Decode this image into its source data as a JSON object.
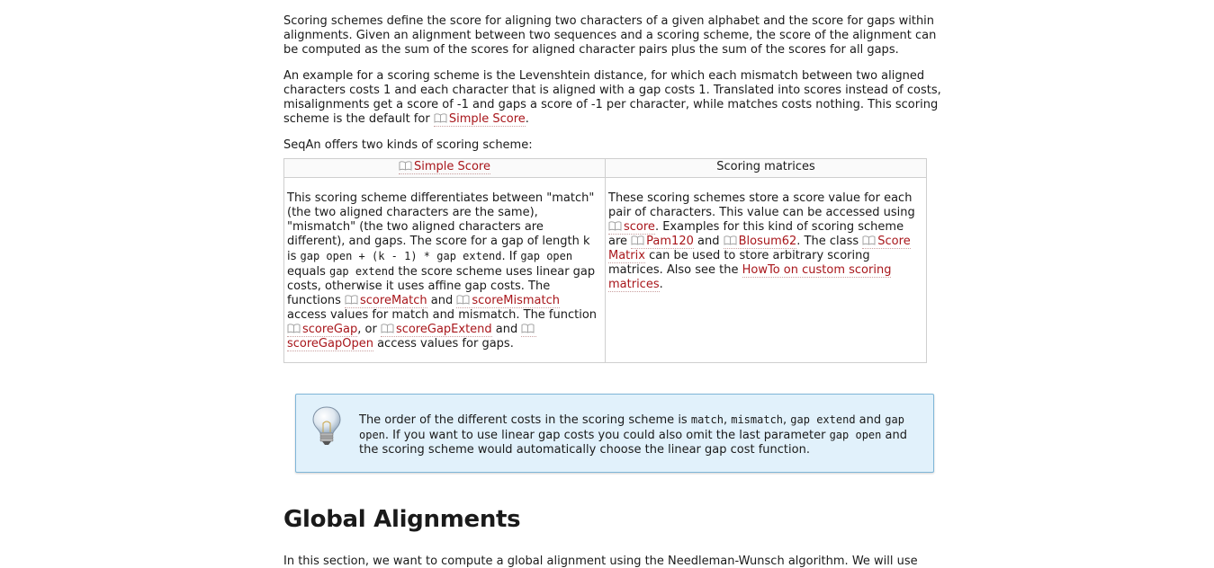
{
  "intro": {
    "p1": "Scoring schemes define the score for aligning two characters of a given alphabet and the score for gaps within alignments. Given an alignment between two sequences and a scoring scheme, the score of the alignment can be computed as the sum of the scores for aligned character pairs plus the sum of the scores for all gaps.",
    "p2_text": "An example for a scoring scheme is the Levenshtein distance, for which each mismatch between two aligned characters costs 1 and each character that is aligned with a gap costs 1. Translated into scores instead of costs, misalignments get a score of -1 and gaps a score of -1 per character, while matches costs nothing. This scoring scheme is the default for ",
    "p2_link": "Simple Score",
    "p2_end": ".",
    "p3": "SeqAn offers two kinds of scoring scheme:"
  },
  "table": {
    "col1_header_link": "Simple Score",
    "col2_header": "Scoring matrices",
    "col1": {
      "t1": "This scoring scheme differentiates between \"match\" (the two aligned characters are the same), \"mismatch\" (the two aligned characters are different), and gaps. The score for a gap of length k is ",
      "c1": "gap open + (k - 1) * gap extend",
      "t2": ". If ",
      "c2": "gap open",
      "t3": " equals ",
      "c3": "gap extend",
      "t4": " the score scheme uses linear gap costs, otherwise it uses affine gap costs. The functions ",
      "l1": "scoreMatch",
      "t5": " and ",
      "l2": "scoreMismatch",
      "t6": " access values for match and mismatch. The function ",
      "l3": "scoreGap",
      "t7": ", or ",
      "l4": "scoreGapExtend",
      "t8": " and ",
      "l5": "scoreGapOpen",
      "t9": " access values for gaps."
    },
    "col2": {
      "t1": "These scoring schemes store a score value for each pair of characters. This value can be accessed using ",
      "l1": "score",
      "t2": ". Examples for this kind of scoring scheme are ",
      "l2": "Pam120",
      "t3": " and ",
      "l3": "Blosum62",
      "t4": ". The class ",
      "l4": "Score Matrix",
      "t5": " can be used to store arbitrary scoring matrices. Also see the ",
      "l5": "HowTo on custom scoring matrices",
      "t6": "."
    }
  },
  "tip": {
    "t1": "The order of the different costs in the scoring scheme is ",
    "c1": "match",
    "t2": ", ",
    "c2": "mismatch",
    "t3": ", ",
    "c3": "gap extend",
    "t4": " and ",
    "c4": "gap open",
    "t5": ". If you want to use linear gap costs you could also omit the last parameter ",
    "c5": "gap open",
    "t6": " and the scoring scheme would automatically choose the linear gap cost function."
  },
  "section": {
    "heading": "Global Alignments",
    "cutoff_text": "In this section, we want to compute a global alignment using the Needleman-Wunsch algorithm. We will use"
  },
  "colors": {
    "link": "#a8161b",
    "tip_bg": "#e1f1fb",
    "tip_border": "#7fb6d8"
  },
  "icons": {
    "doc_link": "book-icon",
    "tip": "lightbulb-icon"
  }
}
